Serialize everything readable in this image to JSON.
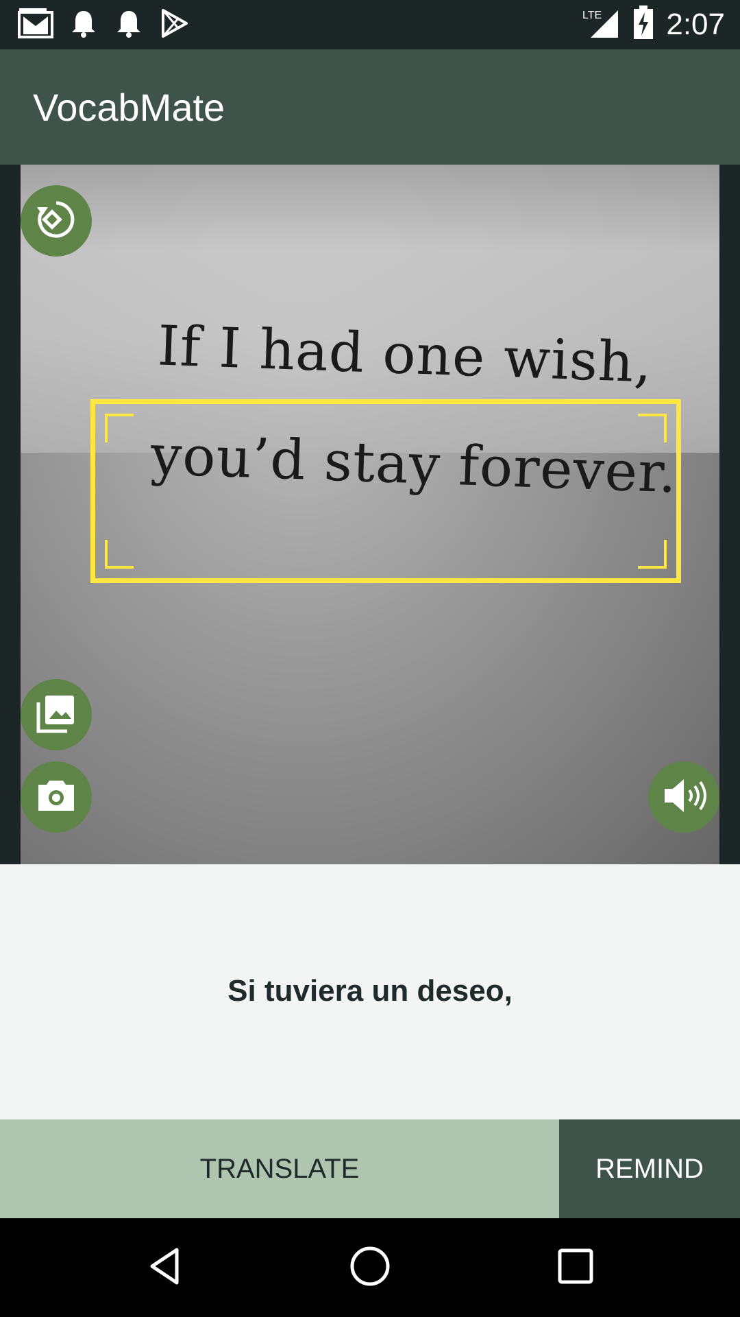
{
  "status_bar": {
    "time": "2:07",
    "network": "LTE",
    "icons": [
      "gmail-icon",
      "notification-bell-icon",
      "notification-bell-icon",
      "play-store-icon",
      "signal-icon",
      "battery-charging-icon"
    ]
  },
  "app_bar": {
    "title": "VocabMate"
  },
  "camera": {
    "photo_line_1": "If I had one wish,",
    "photo_line_2": "you’d stay forever.",
    "focus_box_color": "#fde740",
    "buttons": [
      "rotate-icon",
      "gallery-icon",
      "camera-icon",
      "speaker-icon"
    ]
  },
  "translation": {
    "text": "Si tuviera un deseo,"
  },
  "actions": {
    "translate_label": "TRANSLATE",
    "remind_label": "REMIND"
  },
  "nav_bar": {
    "buttons": [
      "back-icon",
      "home-icon",
      "recents-icon"
    ]
  },
  "colors": {
    "primary": "#3e534a",
    "accent_fab": "#5e8448",
    "translate_button": "#afc5b0",
    "focus_box": "#fde740"
  }
}
